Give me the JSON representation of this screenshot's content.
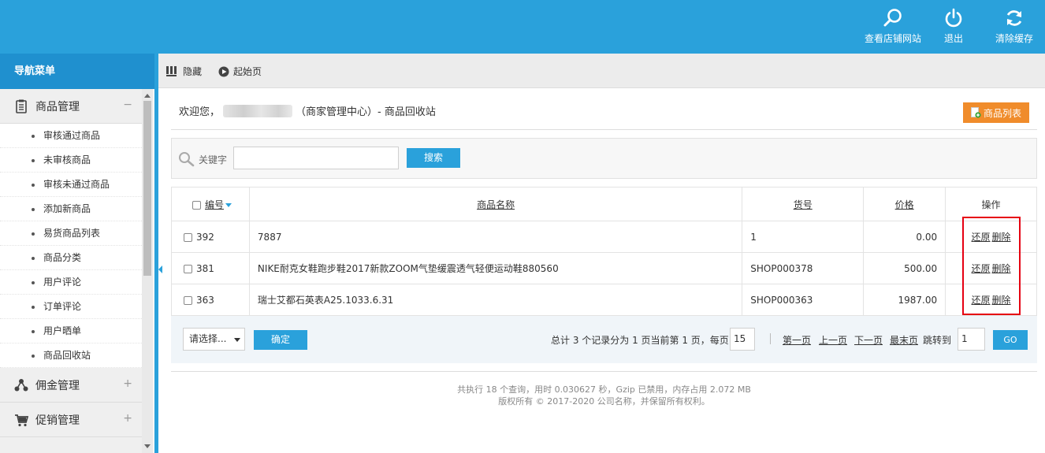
{
  "topbar": {
    "actions": [
      {
        "label": "查看店铺网站",
        "icon": "search-icon"
      },
      {
        "label": "退出",
        "icon": "power-icon"
      },
      {
        "label": "清除缓存",
        "icon": "refresh-icon"
      }
    ]
  },
  "sidebar": {
    "title": "导航菜单",
    "groups": [
      {
        "label": "商品管理",
        "icon": "document-icon",
        "toggle": "−",
        "items": [
          "审核通过商品",
          "未审核商品",
          "审核未通过商品",
          "添加新商品",
          "易货商品列表",
          "商品分类",
          "用户评论",
          "订单评论",
          "用户晒单",
          "商品回收站"
        ]
      },
      {
        "label": "佣金管理",
        "icon": "network-icon",
        "toggle": "+"
      },
      {
        "label": "促销管理",
        "icon": "cart-icon",
        "toggle": "+"
      }
    ]
  },
  "crumbbar": {
    "hide_label": "隐藏",
    "home_label": "起始页"
  },
  "main": {
    "welcome_prefix": "欢迎您，",
    "welcome_suffix": "（商家管理中心）- 商品回收站",
    "list_button": "商品列表"
  },
  "search": {
    "keyword_label": "关键字",
    "input_value": "",
    "button": "搜索"
  },
  "table": {
    "headers": {
      "id": "编号",
      "name": "商品名称",
      "sn": "货号",
      "price": "价格",
      "ops": "操作"
    },
    "restore_label": "还原",
    "delete_label": "删除",
    "rows": [
      {
        "id": "392",
        "name": "7887",
        "sn": "1",
        "price": "0.00"
      },
      {
        "id": "381",
        "name": "NIKE耐克女鞋跑步鞋2017新款ZOOM气垫缓震透气轻便运动鞋880560",
        "sn": "SHOP000378",
        "price": "500.00"
      },
      {
        "id": "363",
        "name": "瑞士艾都石英表A25.1033.6.31",
        "sn": "SHOP000363",
        "price": "1987.00"
      }
    ]
  },
  "pager": {
    "select_value": "请选择...",
    "confirm": "确定",
    "summary": "总计 3 个记录分为 1 页当前第 1 页，每页",
    "per_page": "15",
    "first": "第一页",
    "prev": "上一页",
    "next": "下一页",
    "last": "最末页",
    "jump_label": "跳转到",
    "jump_value": "1",
    "go": "GO"
  },
  "footer": {
    "line1": "共执行 18 个查询，用时 0.030627 秒，Gzip 已禁用，内存占用 2.072 MB",
    "line2": "版权所有 © 2017-2020 公司名称，并保留所有权利。"
  },
  "colors": {
    "primary": "#2aa1db",
    "sidebar_title": "#1f90cf",
    "accent_button": "#f08c2b",
    "highlight": "#e60012"
  }
}
